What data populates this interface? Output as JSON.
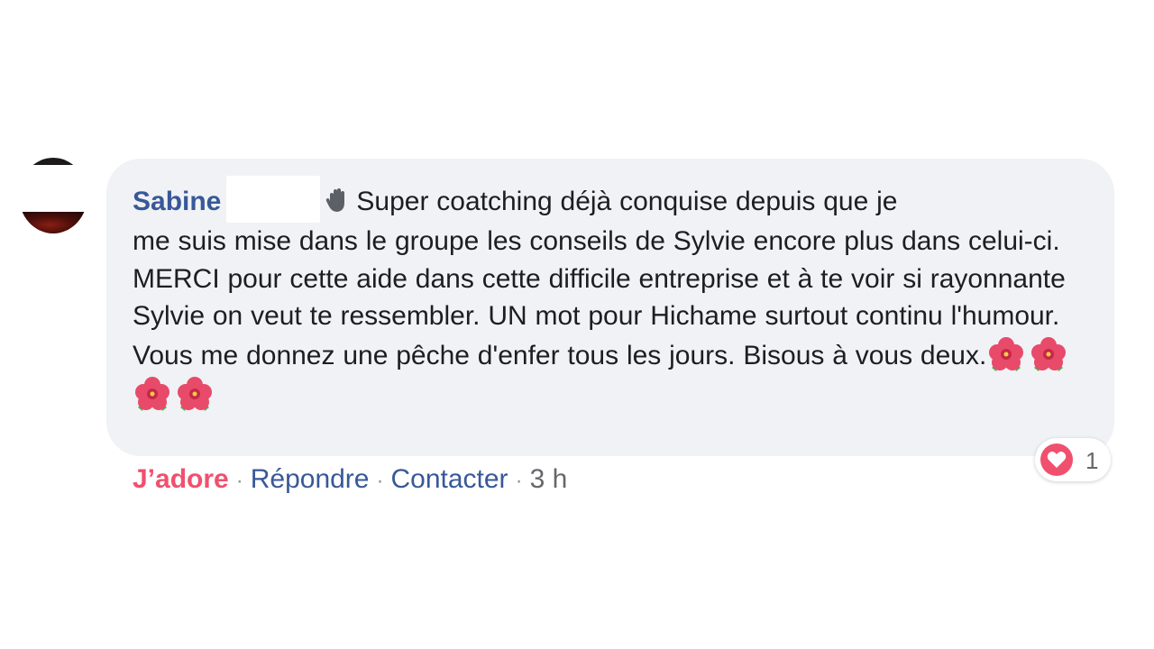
{
  "comment": {
    "author": "Sabine",
    "text_line1": "Super coatching déjà conquise depuis que je",
    "text_rest": "me suis mise dans le groupe les conseils de Sylvie encore plus dans celui-ci. MERCI pour cette aide dans cette difficile entreprise et à te voir si rayonnante Sylvie on veut te ressembler. UN mot pour Hichame surtout continu l'humour. Vous me donnez une pêche d'enfer tous les jours. Bisous à vous deux.",
    "leading_emoji": "waving-hand-icon",
    "trailing_emoji": [
      "hibiscus-icon",
      "hibiscus-icon",
      "hibiscus-icon",
      "hibiscus-icon"
    ]
  },
  "reactions": {
    "icon": "heart-icon",
    "count": "1"
  },
  "actions": {
    "love_label": "J’adore",
    "reply_label": "Répondre",
    "contact_label": "Contacter",
    "separator": "·",
    "time": "3 h"
  },
  "colors": {
    "bubble": "#f0f2f5",
    "author": "#385898",
    "love": "#f0506e",
    "link": "#385898",
    "muted": "#65676b"
  }
}
